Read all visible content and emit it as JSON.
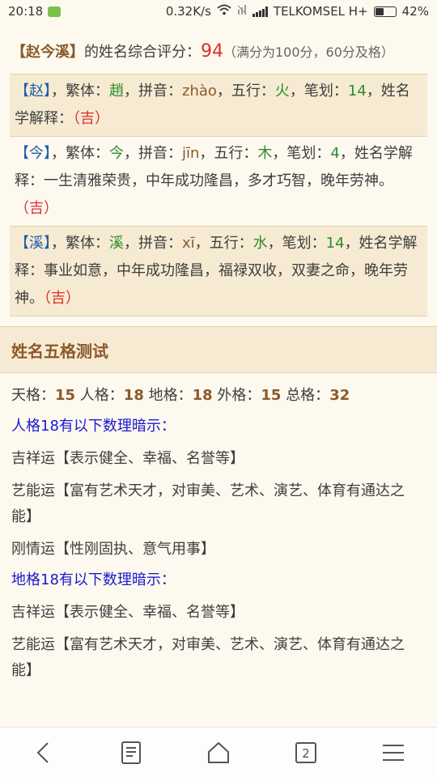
{
  "status_bar": {
    "time": "20:18",
    "speed": "0.32K/s",
    "carrier": "TELKOMSEL H+",
    "battery_percent": "42%",
    "battery_level": 0.42
  },
  "score": {
    "name_bracket": "【赵今溪】",
    "label": "的姓名综合评分：",
    "value": "94",
    "note": "（满分为100分，60分及格）"
  },
  "characters": [
    {
      "char_bracket": "【赵】",
      "traditional_label": "，繁体：",
      "traditional": "趙",
      "pinyin_label": "，拼音：",
      "pinyin": "zhào",
      "wuxing_label": "，五行：",
      "wuxing": "火",
      "strokes_label": "，笔划：",
      "strokes": "14",
      "explain_label": "，姓名学解释：",
      "explain": "",
      "luck_open": "（",
      "luck": "吉",
      "luck_close": "）"
    },
    {
      "char_bracket": "【今】",
      "traditional_label": "，繁体：",
      "traditional": "今",
      "pinyin_label": "，拼音：",
      "pinyin": "jīn",
      "wuxing_label": "，五行：",
      "wuxing": "木",
      "strokes_label": "，笔划：",
      "strokes": "4",
      "explain_label": "，姓名学解释：",
      "explain": "一生清雅荣贵，中年成功隆昌，多才巧智，晚年劳神。",
      "luck_open": "（",
      "luck": "吉",
      "luck_close": "）"
    },
    {
      "char_bracket": "【溪】",
      "traditional_label": "，繁体：",
      "traditional": "溪",
      "pinyin_label": "，拼音：",
      "pinyin": "xī",
      "wuxing_label": "，五行：",
      "wuxing": "水",
      "strokes_label": "，笔划：",
      "strokes": "14",
      "explain_label": "，姓名学解释：",
      "explain": "事业如意，中年成功隆昌，福禄双收，双妻之命，晚年劳神。",
      "luck_open": "（",
      "luck": "吉",
      "luck_close": "）"
    }
  ],
  "wuge": {
    "title": "姓名五格测试",
    "tian_label": "天格：",
    "tian": "15",
    "ren_label": "人格：",
    "ren": "18",
    "di_label": "地格：",
    "di": "18",
    "wai_label": "外格：",
    "wai": "15",
    "zong_label": "总格：",
    "zong": "32",
    "renge_hint": "人格18有以下数理暗示：",
    "renge_items": [
      "吉祥运【表示健全、幸福、名誉等】",
      "艺能运【富有艺术天才，对审美、艺术、演艺、体育有通达之能】",
      "刚情运【性刚固执、意气用事】"
    ],
    "dige_hint": "地格18有以下数理暗示：",
    "dige_items": [
      "吉祥运【表示健全、幸福、名誉等】",
      "艺能运【富有艺术天才，对审美、艺术、演艺、体育有通达之能】"
    ]
  },
  "bottom_nav": {
    "tab_count": "2"
  }
}
